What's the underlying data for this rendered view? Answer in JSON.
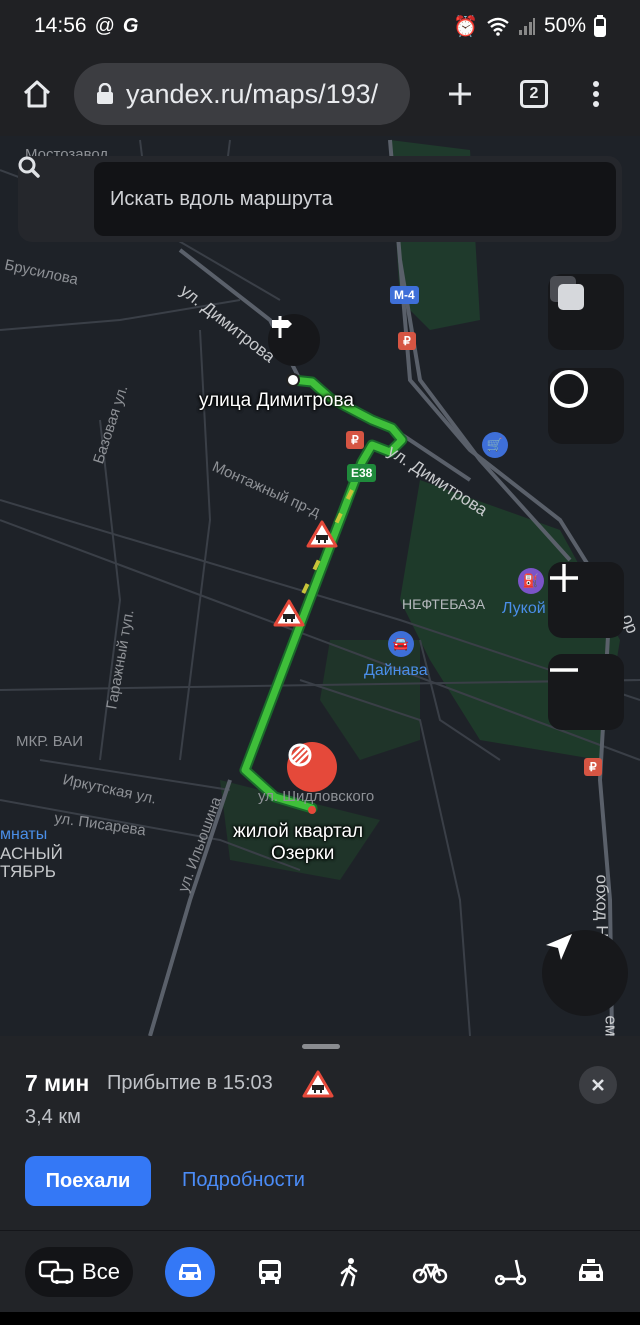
{
  "status_bar": {
    "time": "14:56",
    "battery": "50%"
  },
  "browser": {
    "url": "yandex.ru/maps/193/",
    "tab_count": "2"
  },
  "map": {
    "search_placeholder": "Искать вдоль маршрута",
    "streets": {
      "s1": "Мостозавод",
      "s2": "Брусилова",
      "s3": "ул. Димитрова",
      "s4": "Базовая ул.",
      "s5": "ул. Димитрова",
      "s6": "Монтажный пр-д",
      "s7": "Гаражный туп.",
      "s8": "МКР. ВАИ",
      "s9": "Иркутская ул.",
      "s10": "ул. Писарева",
      "s11": "ул. Ильюшина",
      "s12": "ул. Шидловского",
      "s13": "обход Н",
      "s14": "ем",
      "s15": "мнаты",
      "s16": "АСНЫЙ",
      "s17": "ТЯБРЬ",
      "s18": "ор"
    },
    "pois": {
      "neftebaza": "НЕФТЕБАЗА",
      "dainava": "Дайнава",
      "lukoil": "Лукой"
    },
    "route": {
      "start_label": "улица Димитрова",
      "end_label_line1": "жилой квартал",
      "end_label_line2": "Озерки",
      "road_badge_m4": "М-4",
      "road_badge_e38": "E38"
    }
  },
  "route_info": {
    "duration": "7 мин",
    "arrival": "Прибытие в 15:03",
    "distance": "3,4 км",
    "go_button": "Поехали",
    "details_link": "Подробности"
  },
  "transport_modes": {
    "all_label": "Все"
  },
  "colors": {
    "route_green": "#3fbf3a",
    "accent_blue": "#3478f6",
    "warning_red": "#e5493a",
    "map_bg": "#1e2228"
  }
}
